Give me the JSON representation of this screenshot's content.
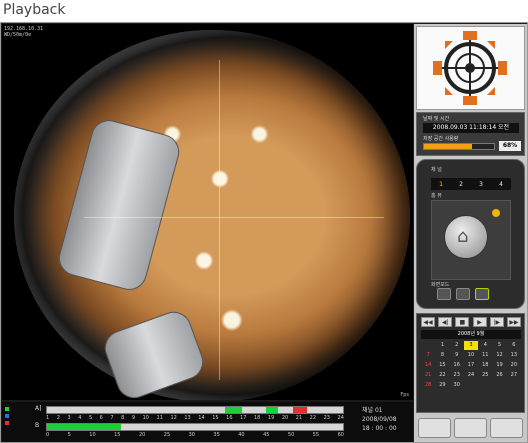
{
  "app": {
    "title": "Playback"
  },
  "video": {
    "cam_info_line1": "192.168.10.31",
    "cam_info_line2": "WD/50m/0e",
    "fps": "Fps"
  },
  "timeline": {
    "legend": [
      "",
      "",
      ""
    ],
    "row1_label": "A]",
    "row2_label": "B",
    "ticks_top": [
      "1",
      "2",
      "3",
      "4",
      "5",
      "6",
      "7",
      "8",
      "9",
      "10",
      "11",
      "12",
      "13",
      "14",
      "15",
      "16",
      "17",
      "18",
      "19",
      "20",
      "21",
      "22",
      "23",
      "24"
    ],
    "ticks_bottom": [
      "0",
      "5",
      "10",
      "15",
      "20",
      "25",
      "30",
      "35",
      "40",
      "45",
      "50",
      "55",
      "60"
    ],
    "channel_label": "채널 01",
    "date": "2008/09/08",
    "time": "18 : 00 : 00"
  },
  "panel": {
    "datetime_label": "날짜 및 시간",
    "datetime_value": "2008.09.03  11:18:14 오전",
    "storage_label": "저장 공간 사용량",
    "storage_percent": "68%",
    "storage_fraction": 0.68,
    "channel_section_label": "채 널",
    "channels": [
      "1",
      "2",
      "3",
      "4"
    ],
    "active_channel": "1",
    "home_section_label": "홈 뷰",
    "view_section_label": "화면모드",
    "calendar_header": "2008년 9월",
    "calendar_days": [
      "",
      "1",
      "2",
      "3",
      "4",
      "5",
      "6",
      "7",
      "8",
      "9",
      "10",
      "11",
      "12",
      "13",
      "14",
      "15",
      "16",
      "17",
      "18",
      "19",
      "20",
      "21",
      "22",
      "23",
      "24",
      "25",
      "26",
      "27",
      "28",
      "29",
      "30"
    ],
    "selected_day": "3",
    "bottom_buttons": [
      "",
      "",
      ""
    ]
  },
  "colors": {
    "accent_orange": "#f0a010",
    "cal_selected": "#f2e200",
    "ptz_orange": "#e07020"
  }
}
